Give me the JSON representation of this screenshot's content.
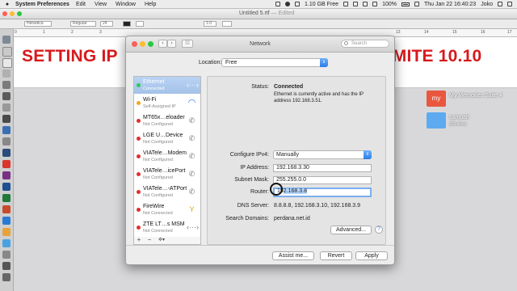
{
  "menubar": {
    "app_name": "System Preferences",
    "items": [
      "Edit",
      "View",
      "Window",
      "Help"
    ],
    "memory_status": "1.10 GB Free",
    "battery": "100%",
    "clock": "Thu Jan 22  16:40:23",
    "user": "Joko"
  },
  "document": {
    "title": "Untitled 5.rtf",
    "status": "— Edited",
    "font_family": "Helvetica",
    "font_style": "Regular",
    "font_size": "24",
    "spacing": "1.0",
    "banner_left": "SETTING IP",
    "banner_right": "OSIMITE 10.10",
    "ruler_marks": [
      "0",
      "1",
      "2",
      "3",
      "4",
      "5",
      "6",
      "7",
      "8",
      "9",
      "10",
      "11",
      "12",
      "13",
      "14",
      "15",
      "16",
      "17"
    ]
  },
  "desktop": {
    "items": [
      {
        "label": "My Memories Suite 4",
        "sub": "",
        "icon_text": "my"
      },
      {
        "label": "sampah",
        "sub": "265 items",
        "icon_text": ""
      }
    ]
  },
  "network_window": {
    "title": "Network",
    "search_placeholder": "Search",
    "location_label": "Location:",
    "location_value": "Free",
    "services": [
      {
        "name": "Ethernet",
        "status": "Connected",
        "dot": "#34c759",
        "icon": "ethernet-icon",
        "glyph": "‹···›"
      },
      {
        "name": "Wi-Fi",
        "status": "Self-Assigned IP",
        "dot": "#f5a623",
        "icon": "wifi-icon",
        "glyph": "◠"
      },
      {
        "name": "MT65x…eloader",
        "status": "Not Configured",
        "dot": "#e0302e",
        "icon": "phone-icon",
        "glyph": "✆"
      },
      {
        "name": "LGE U…Device",
        "status": "Not Configured",
        "dot": "#e0302e",
        "icon": "phone-icon",
        "glyph": "✆"
      },
      {
        "name": "VIATele…Modem",
        "status": "Not Configured",
        "dot": "#e0302e",
        "icon": "phone-icon",
        "glyph": "✆"
      },
      {
        "name": "VIATele…icePort",
        "status": "Not Configured",
        "dot": "#e0302e",
        "icon": "phone-icon",
        "glyph": "✆"
      },
      {
        "name": "VIATele…-ATPort",
        "status": "Not Configured",
        "dot": "#e0302e",
        "icon": "phone-icon",
        "glyph": "✆"
      },
      {
        "name": "FireWire",
        "status": "Not Connected",
        "dot": "#e0302e",
        "icon": "firewire-icon",
        "glyph": "Y"
      },
      {
        "name": "ZTE LT…s MSM",
        "status": "Not Connected",
        "dot": "#e0302e",
        "icon": "ethernet-icon",
        "glyph": "‹···›"
      }
    ],
    "list_footer": [
      "+",
      "−",
      "✲▾"
    ],
    "status_label": "Status:",
    "status_value": "Connected",
    "status_desc": "Ethernet is currently active and has the IP address 192.168.3.51.",
    "configure_label": "Configure IPv4:",
    "configure_value": "Manually",
    "ip_label": "IP Address:",
    "ip_value": "192.168.3.30",
    "subnet_label": "Subnet Mask:",
    "subnet_value": "255.255.0.0",
    "router_label": "Router:",
    "router_value_prefix": "19",
    "router_value_selected": "2.168.3.8",
    "dns_label": "DNS Server:",
    "dns_value": "8.8.8.8, 192.168.3.10, 192.168.3.9",
    "search_domains_label": "Search Domains:",
    "search_domains_value": "perdana.net.id",
    "advanced_label": "Advanced...",
    "help_label": "?",
    "assist_label": "Assist me...",
    "revert_label": "Revert",
    "apply_label": "Apply"
  },
  "colors": {
    "banner_red": "#d7191c",
    "selection_blue": "#a5c2e8",
    "accent_blue": "#2c7ce9",
    "connected_green": "#34c759",
    "warning_amber": "#f5a623",
    "error_red": "#e0302e"
  }
}
